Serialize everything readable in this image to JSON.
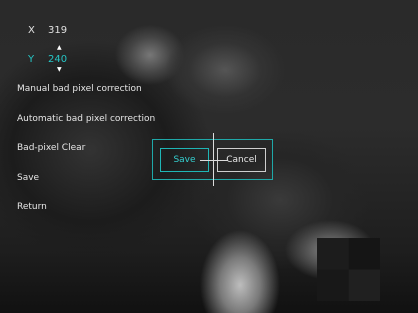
{
  "coords": {
    "x": {
      "label": "X",
      "value": "319"
    },
    "y": {
      "label": "Y",
      "value": "240"
    }
  },
  "menu": [
    "Manual bad pixel correction",
    "Automatic bad pixel correction",
    "Bad-pixel Clear",
    "Save",
    "Return"
  ],
  "dialog": {
    "save_label": "Save",
    "cancel_label": "Cancel"
  },
  "icons": {
    "up": "arrow-up-icon",
    "down": "arrow-down-icon"
  },
  "colors": {
    "accent": "#26c6c6",
    "text": "#e6e6e6"
  }
}
